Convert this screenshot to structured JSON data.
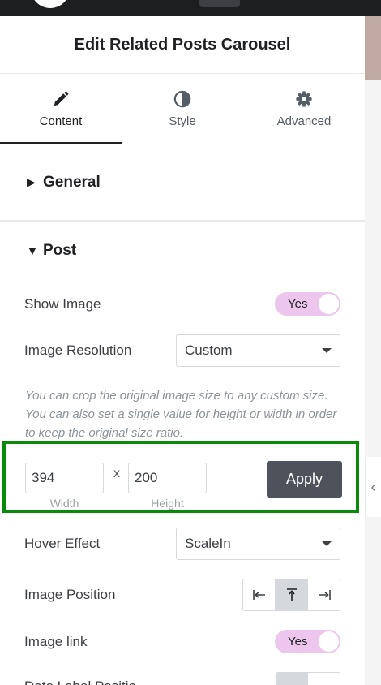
{
  "panel": {
    "title": "Edit Related Posts Carousel"
  },
  "tabs": [
    {
      "label": "Content",
      "icon": "pencil-icon",
      "active": true
    },
    {
      "label": "Style",
      "icon": "half-circle-icon",
      "active": false
    },
    {
      "label": "Advanced",
      "icon": "gear-icon",
      "active": false
    }
  ],
  "sections": {
    "general": "General",
    "post": "Post"
  },
  "show_image": {
    "label": "Show Image",
    "toggle": "Yes"
  },
  "image_resolution": {
    "label": "Image Resolution",
    "value": "Custom"
  },
  "help_text": "You can crop the original image size to any custom size. You can also set a single value for height or width in order to keep the original size ratio.",
  "dimensions": {
    "width_value": "394",
    "height_value": "200",
    "separator": "x",
    "width_caption": "Width",
    "height_caption": "Height",
    "apply_label": "Apply"
  },
  "hover_effect": {
    "label": "Hover Effect",
    "value": "ScaleIn"
  },
  "image_position": {
    "label": "Image Position",
    "options": [
      "left",
      "top",
      "right"
    ],
    "selected": "top"
  },
  "image_link": {
    "label": "Image link",
    "toggle": "Yes"
  },
  "cutoff_row": {
    "label": "Date Label Positio"
  },
  "colors": {
    "toggle": "#ecc6ec",
    "highlight": "#0a8a0a",
    "apply_button": "#4e525a"
  }
}
